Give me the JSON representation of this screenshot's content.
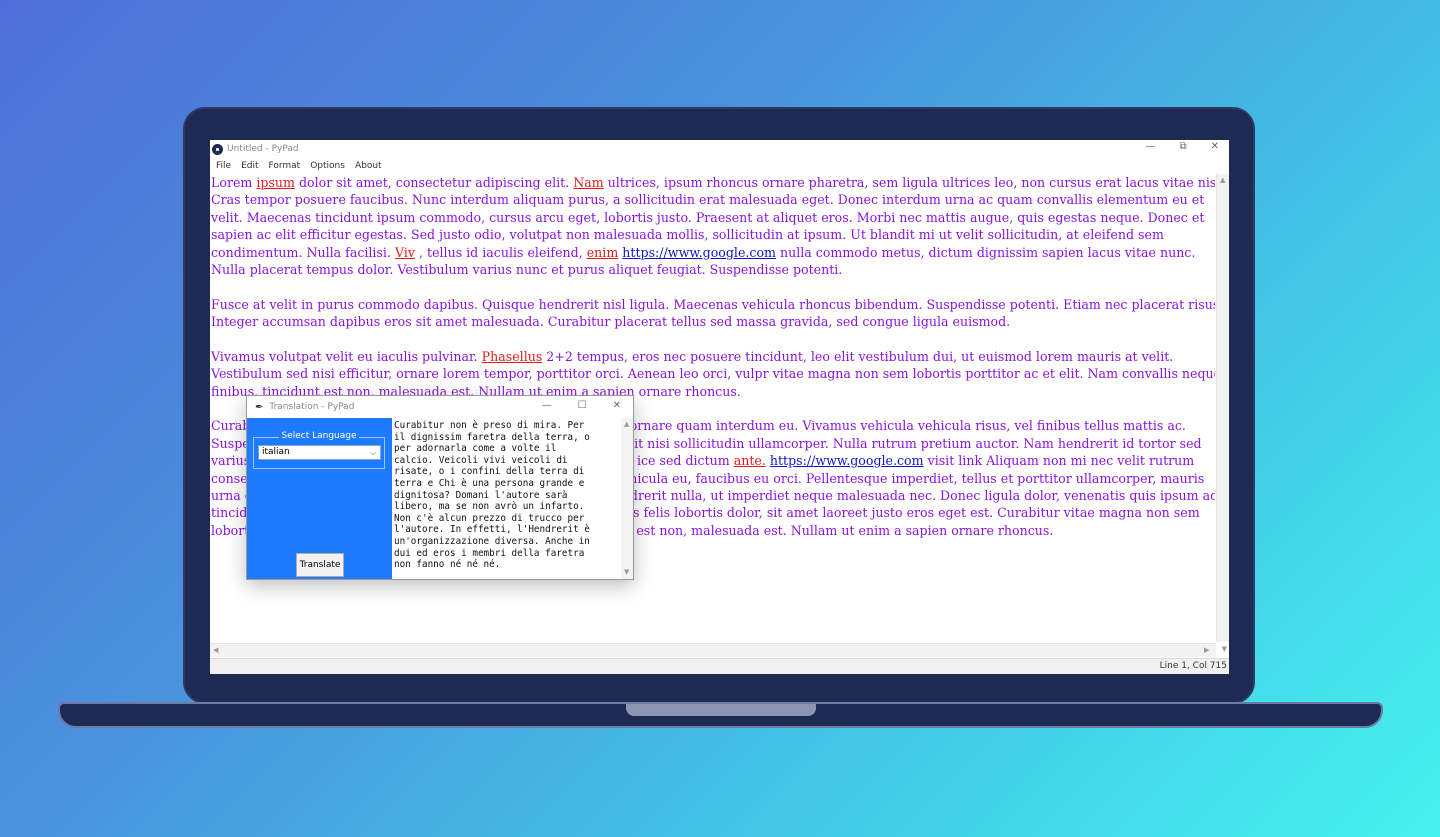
{
  "window": {
    "title": "Untitled - PyPad",
    "controls": [
      "—",
      "⧉",
      "✕"
    ]
  },
  "menu": [
    "File",
    "Edit",
    "Format",
    "Options",
    "About"
  ],
  "editor_lines": [
    [
      {
        "t": "Lorem "
      },
      {
        "t": "ipsum",
        "k": "kw"
      },
      {
        "t": " dolor  sit amet, consectetur adipiscing elit. "
      },
      {
        "t": "Nam",
        "k": "kw"
      },
      {
        "t": "  ultrices, ipsum rhoncus ornare pharetra, sem ligula ultrices leo, non cursus erat lacus vitae nisi."
      }
    ],
    [
      {
        "t": "Cras tempor posuere faucibus. Nunc interdum aliquam purus, a sollicitudin erat malesuada eget. Donec interdum urna ac quam convallis elementum eu et"
      }
    ],
    [
      {
        "t": "velit. Maecenas tincidunt ipsum commodo, cursus arcu eget, lobortis justo. Praesent at aliquet eros. Morbi nec mattis augue, quis egestas neque. Donec et"
      }
    ],
    [
      {
        "t": "sapien ac elit efficitur egestas. Sed justo odio, volutpat non malesuada mollis, sollicitudin at ipsum. Ut blandit mi ut velit sollicitudin, at eleifend sem"
      }
    ],
    [
      {
        "t": "condimentum. Nulla facilisi. "
      },
      {
        "t": "Viv",
        "k": "kw"
      },
      {
        "t": "  , tellus id iaculis eleifend, "
      },
      {
        "t": "enim",
        "k": "kw"
      },
      {
        "t": " "
      },
      {
        "t": "https://www.google.com",
        "k": "url"
      },
      {
        "t": " nulla commodo metus, dictum dignissim sapien lacus vitae nunc."
      }
    ],
    [
      {
        "t": "Nulla placerat tempus dolor. Vestibulum varius nunc et purus aliquet feugiat. Suspendisse potenti."
      }
    ],
    [
      {
        "t": ""
      }
    ],
    [
      {
        "t": "Fusce at velit in purus commodo dapibus. Quisque hendrerit nisl ligula. Maecenas vehicula rhoncus bibendum. Suspendisse potenti. Etiam nec placerat risus."
      }
    ],
    [
      {
        "t": "Integer accumsan dapibus eros sit amet malesuada. Curabitur placerat tellus sed massa gravida, sed congue ligula euismod."
      }
    ],
    [
      {
        "t": ""
      }
    ],
    [
      {
        "t": "Vivamus volutpat velit eu iaculis pulvinar. "
      },
      {
        "t": "Phasellus",
        "k": "kw"
      },
      {
        "t": " 2+2 tempus, eros nec posuere tincidunt, leo elit vestibulum dui, ut euismod lorem mauris at velit."
      }
    ],
    [
      {
        "t": "Vestibulum sed nisi efficitur, ornare lorem tempor, porttitor orci. Aenean leo orci, vulpr vitae magna non sem lobortis porttitor ac et elit. Nam convallis neque"
      }
    ],
    [
      {
        "t": "finibus, tincidunt est non, malesuada est. Nullam ut enim a sapien ornare rhoncus."
      }
    ],
    [
      {
        "t": ""
      }
    ],
    [
      {
        "t": "Curabitur non est ac justo vehicula ullamcorper. Integer pretium ornare quam interdum eu. Vivamus vehicula vehicula risus, vel finibus tellus mattis ac."
      }
    ],
    [
      {
        "t": "Suspendisse potenti. Donec auctor justo et odio faucibus, id blandit nisi sollicitudin ullamcorper. Nulla rutrum pretium auctor. Nam hendrerit id tortor sed"
      }
    ],
    [
      {
        "t": "varius. Etiam sed lacus risus. Mauris molestie, eros vitae pulvinar ice sed dictum "
      },
      {
        "t": "ante.",
        "k": "kw"
      },
      {
        "t": " "
      },
      {
        "t": "https://www.google.com",
        "k": "url"
      },
      {
        "t": " visit link Aliquam non mi nec velit rutrum"
      }
    ],
    [
      {
        "t": "consectetur. Nunc sollicitudin a nibh et pulvinar. Morbi cursus vehicula eu, faucibus eu orci. Pellentesque imperdiet, tellus et porttitor ullamcorper, mauris"
      }
    ],
    [
      {
        "t": "urna commodo metus, vitae dapibus erat urna et felis. Donec hendrerit nulla, ut imperdiet neque malesuada nec. Donec ligula dolor, venenatis quis ipsum ac,"
      }
    ],
    [
      {
        "t": "tincidunt mattis diam. Duis vestibulum elementum nulla, ac cursus felis lobortis dolor, sit amet laoreet justo eros eget est. Curabitur vitae magna non sem"
      }
    ],
    [
      {
        "t": "lobortis porttitor ac et elit. Nam convallis neque finibus, tincidunt est non, malesuada est. Nullam ut enim a sapien ornare rhoncus."
      }
    ]
  ],
  "status": {
    "position": "Line 1, Col 715"
  },
  "dialog": {
    "title": "Translation - PyPad",
    "controls": [
      "—",
      "☐",
      "✕"
    ],
    "select_label": "Select Language",
    "selected_language": "italian",
    "translate_label": "Translate",
    "output_lines": [
      "Curabitur non è preso di mira. Per",
      "il dignissim faretra della terra, o",
      "per adornarla come a volte il",
      "calcio. Veicoli vivi veicoli di",
      "risate, o i confini della terra di",
      "terra e Chi è una persona grande e",
      "dignitosa? Domani l'autore sarà",
      "libero, ma se non avrò un infarto.",
      "Non c'è alcun prezzo di trucco per",
      "l'autore. In effetti, l'Hendrerit è",
      "un'organizzazione diversa. Anche in",
      "dui ed eros i membri della faretra",
      "non fanno né né né."
    ]
  },
  "colors": {
    "editor_text": "#8a14d9",
    "keyword": "#e01a1a",
    "url": "#1414c8",
    "dialog_panel": "#1e7bff"
  }
}
